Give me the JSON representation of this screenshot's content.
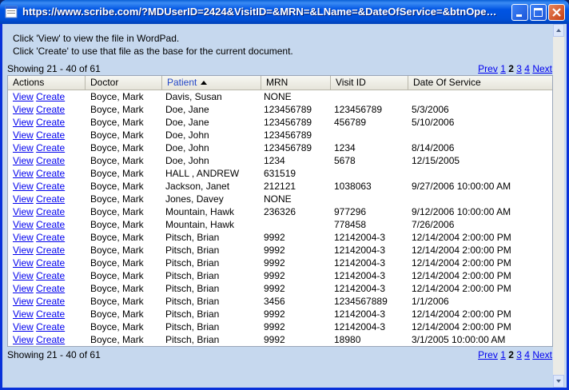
{
  "window": {
    "title": "https://www.scribe.com/?MDUserID=2424&VisitID=&MRN=&LName=&DateOfService=&btnOpen=..."
  },
  "info": {
    "line1": "Click 'View' to view the file in WordPad.",
    "line2": "Click 'Create' to use that file as the base for the current document."
  },
  "pager": {
    "showing": "Showing 21 - 40 of 61",
    "prev": "Prev",
    "pages": [
      "1",
      "2",
      "3",
      "4"
    ],
    "current": "2",
    "next": "Next"
  },
  "table": {
    "columns": [
      "Actions",
      "Doctor",
      "Patient",
      "MRN",
      "Visit ID",
      "Date Of Service"
    ],
    "sorted_column": "Patient",
    "sort_direction": "ascending",
    "view_label": "View",
    "create_label": "Create",
    "rows": [
      {
        "doctor": "Boyce, Mark",
        "patient": "Davis, Susan",
        "mrn": "NONE",
        "visit": "",
        "date": ""
      },
      {
        "doctor": "Boyce, Mark",
        "patient": "Doe, Jane",
        "mrn": "123456789",
        "visit": "123456789",
        "date": "5/3/2006"
      },
      {
        "doctor": "Boyce, Mark",
        "patient": "Doe, Jane",
        "mrn": "123456789",
        "visit": "456789",
        "date": "5/10/2006"
      },
      {
        "doctor": "Boyce, Mark",
        "patient": "Doe, John",
        "mrn": "123456789",
        "visit": "",
        "date": ""
      },
      {
        "doctor": "Boyce, Mark",
        "patient": "Doe, John",
        "mrn": "123456789",
        "visit": "1234",
        "date": "8/14/2006"
      },
      {
        "doctor": "Boyce, Mark",
        "patient": "Doe, John",
        "mrn": "1234",
        "visit": "5678",
        "date": "12/15/2005"
      },
      {
        "doctor": "Boyce, Mark",
        "patient": "HALL , ANDREW",
        "mrn": "631519",
        "visit": "",
        "date": ""
      },
      {
        "doctor": "Boyce, Mark",
        "patient": "Jackson, Janet",
        "mrn": "212121",
        "visit": "1038063",
        "date": "9/27/2006 10:00:00 AM"
      },
      {
        "doctor": "Boyce, Mark",
        "patient": "Jones, Davey",
        "mrn": "NONE",
        "visit": "",
        "date": ""
      },
      {
        "doctor": "Boyce, Mark",
        "patient": "Mountain, Hawk",
        "mrn": "236326",
        "visit": "977296",
        "date": "9/12/2006 10:00:00 AM"
      },
      {
        "doctor": "Boyce, Mark",
        "patient": "Mountain, Hawk",
        "mrn": "",
        "visit": "778458",
        "date": "7/26/2006"
      },
      {
        "doctor": "Boyce, Mark",
        "patient": "Pitsch, Brian",
        "mrn": "9992",
        "visit": "12142004-3",
        "date": "12/14/2004 2:00:00 PM"
      },
      {
        "doctor": "Boyce, Mark",
        "patient": "Pitsch, Brian",
        "mrn": "9992",
        "visit": "12142004-3",
        "date": "12/14/2004 2:00:00 PM"
      },
      {
        "doctor": "Boyce, Mark",
        "patient": "Pitsch, Brian",
        "mrn": "9992",
        "visit": "12142004-3",
        "date": "12/14/2004 2:00:00 PM"
      },
      {
        "doctor": "Boyce, Mark",
        "patient": "Pitsch, Brian",
        "mrn": "9992",
        "visit": "12142004-3",
        "date": "12/14/2004 2:00:00 PM"
      },
      {
        "doctor": "Boyce, Mark",
        "patient": "Pitsch, Brian",
        "mrn": "9992",
        "visit": "12142004-3",
        "date": "12/14/2004 2:00:00 PM"
      },
      {
        "doctor": "Boyce, Mark",
        "patient": "Pitsch, Brian",
        "mrn": "3456",
        "visit": "1234567889",
        "date": "1/1/2006"
      },
      {
        "doctor": "Boyce, Mark",
        "patient": "Pitsch, Brian",
        "mrn": "9992",
        "visit": "12142004-3",
        "date": "12/14/2004 2:00:00 PM"
      },
      {
        "doctor": "Boyce, Mark",
        "patient": "Pitsch, Brian",
        "mrn": "9992",
        "visit": "12142004-3",
        "date": "12/14/2004 2:00:00 PM"
      },
      {
        "doctor": "Boyce, Mark",
        "patient": "Pitsch, Brian",
        "mrn": "9992",
        "visit": "18980",
        "date": "3/1/2005 10:00:00 AM"
      }
    ]
  },
  "colors": {
    "titlebar": "#0054e3",
    "background": "#c6d8ee",
    "link": "#0000ee",
    "sorted_header": "#2448c8"
  },
  "icons": [
    "app-icon",
    "minimize-icon",
    "maximize-icon",
    "close-icon",
    "sort-ascending-icon",
    "scroll-up-icon",
    "scroll-down-icon"
  ]
}
